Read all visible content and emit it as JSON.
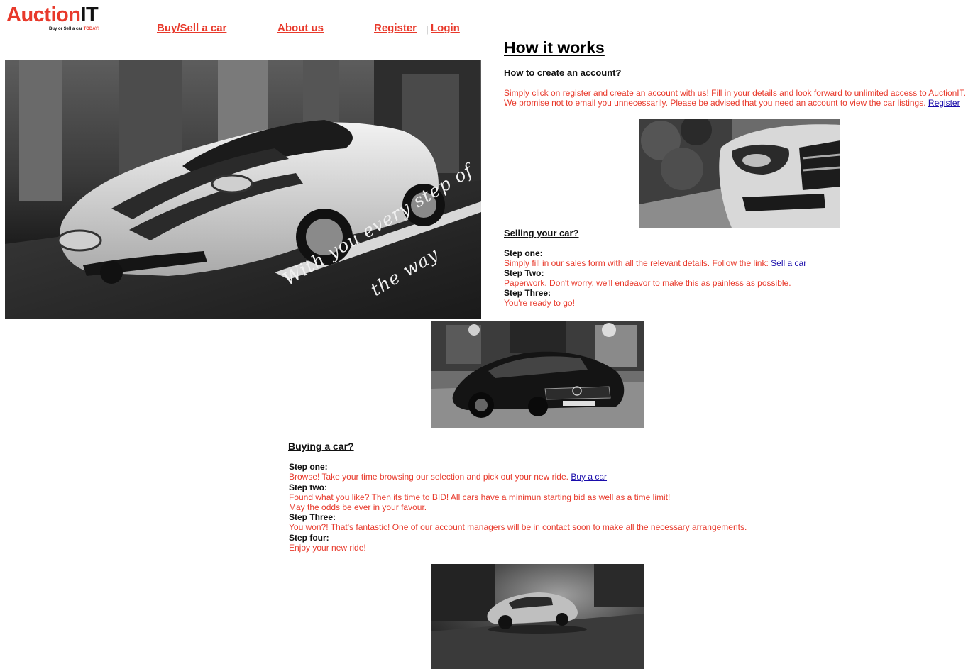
{
  "brand": {
    "name_part1": "Auction",
    "name_part2": "IT",
    "tagline_part1": "Buy or Sell a car ",
    "tagline_part2": "TODAY!"
  },
  "nav": {
    "buy_sell": "Buy/Sell a car",
    "about": "About us",
    "register": "Register",
    "separator": "|",
    "login": "Login"
  },
  "hero": {
    "caption_line1": "With you every step of",
    "caption_line2": "the way"
  },
  "how": {
    "title": "How it works",
    "account": {
      "heading": "How to create an account?",
      "line1": "Simply click on register and create an account with us! Fill in your details and look forward to unlimited access to AuctionIT.",
      "line2": "We promise not to email you unnecessarily. Please be advised that you need an account to view the car listings.",
      "register_link": "Register"
    },
    "selling": {
      "heading": "Selling your car?",
      "step1_label": "Step one:",
      "step1_text": "Simply fill in our sales form with all the relevant details. Follow the link:",
      "step1_link": "Sell a car",
      "step2_label": "Step Two:",
      "step2_text": "Paperwork. Don't worry, we'll endeavor to make this as painless as possible.",
      "step3_label": "Step Three:",
      "step3_text": "You're ready to go!"
    },
    "buying": {
      "heading": "Buying a car?",
      "step1_label": "Step one:",
      "step1_text": "Browse! Take your time browsing our selection and pick out your new ride.",
      "step1_link": "Buy a car",
      "step2_label": "Step two:",
      "step2_text1": "Found what you like? Then its time to BID! All cars have a minimun starting bid as well as a time limit!",
      "step2_text2": "May the odds be ever in your favour.",
      "step3_label": "Step Three:",
      "step3_text": "You won?! That's fantastic! One of our account managers will be in contact soon to make all the necessary arrangements.",
      "step4_label": "Step four:",
      "step4_text": "Enjoy your new ride!"
    }
  },
  "colors": {
    "accent": "#e8392b",
    "link": "#1a0dab",
    "text": "#111111"
  },
  "icons": {
    "hero": "sports-car-photo",
    "merc_front": "car-headlight-photo",
    "merc_dark": "sedan-photo",
    "porsche": "classic-car-photo"
  }
}
